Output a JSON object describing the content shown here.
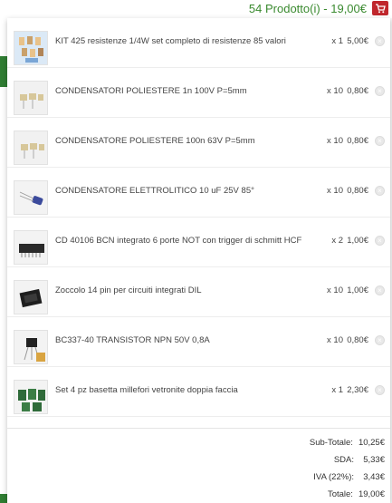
{
  "cart": {
    "summary": "54 Prodotto(i) - 19,00€",
    "icon": "cart-icon",
    "accent_color": "#3a8a2f",
    "icon_color": "#c0272d"
  },
  "items": [
    {
      "name": "KIT 425 resistenze 1/4W set completo di resistenze 85 valori",
      "qty": "x 1",
      "price": "5,00€",
      "thumb": "resistor-kit"
    },
    {
      "name": "CONDENSATORI POLIESTERE 1n 100V P=5mm",
      "qty": "x 10",
      "price": "0,80€",
      "thumb": "capacitor"
    },
    {
      "name": "CONDENSATORE POLIESTERE 100n 63V P=5mm",
      "qty": "x 10",
      "price": "0,80€",
      "thumb": "capacitor"
    },
    {
      "name": "CONDENSATORE ELETTROLITICO 10 uF 25V 85°",
      "qty": "x 10",
      "price": "0,80€",
      "thumb": "electrolytic"
    },
    {
      "name": "CD 40106 BCN integrato 6 porte NOT con trigger di schmitt HCF",
      "qty": "x 2",
      "price": "1,00€",
      "thumb": "ic-chip"
    },
    {
      "name": "Zoccolo 14 pin per circuiti integrati DIL",
      "qty": "x 10",
      "price": "1,00€",
      "thumb": "ic-socket"
    },
    {
      "name": "BC337-40 TRANSISTOR NPN 50V 0,8A",
      "qty": "x 10",
      "price": "0,80€",
      "thumb": "transistor"
    },
    {
      "name": "Set 4 pz basetta millefori vetronite doppia faccia",
      "qty": "x 1",
      "price": "2,30€",
      "thumb": "pcb"
    }
  ],
  "totals": {
    "subtotal_label": "Sub-Totale:",
    "subtotal_value": "10,25€",
    "sda_label": "SDA:",
    "sda_value": "5,33€",
    "iva_label": "IVA (22%):",
    "iva_value": "3,43€",
    "total_label": "Totale:",
    "total_value": "19,00€"
  }
}
